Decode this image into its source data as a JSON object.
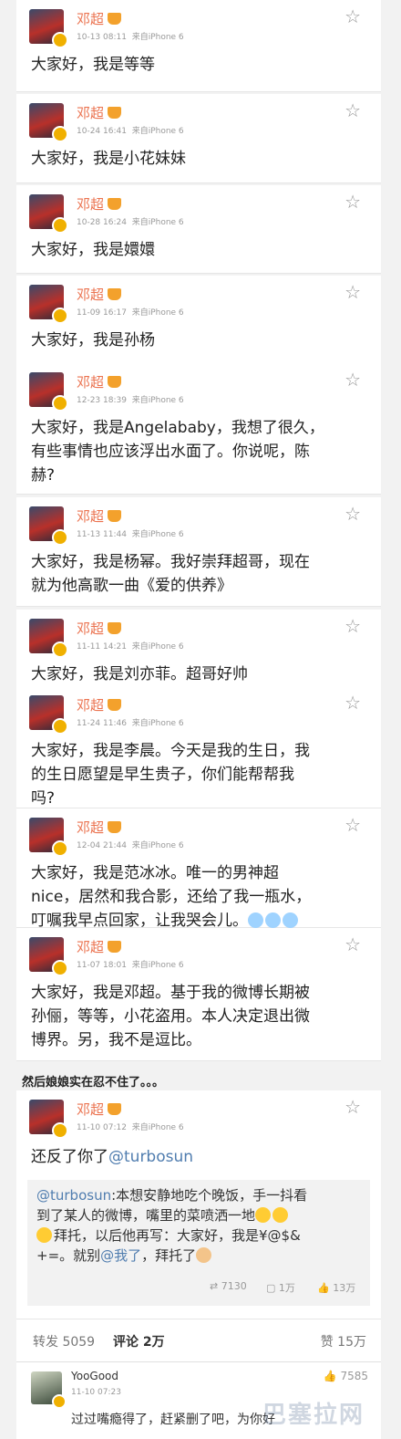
{
  "posts": [
    {
      "name": "邓超",
      "time": "10-13 08:11",
      "source": "来自iPhone 6",
      "text": [
        "大家好，我是等等"
      ]
    },
    {
      "name": "邓超",
      "time": "10-24 16:41",
      "source": "来自iPhone 6",
      "text": [
        "大家好，我是小花妹妹"
      ]
    },
    {
      "name": "邓超",
      "time": "10-28 16:24",
      "source": "来自iPhone 6",
      "text": [
        "大家好，我是嬛嬛"
      ]
    },
    {
      "name": "邓超",
      "time": "11-09 16:17",
      "source": "来自iPhone 6",
      "text": [
        "大家好，我是孙杨"
      ]
    },
    {
      "name": "邓超",
      "time": "12-23 18:39",
      "source": "来自iPhone 6",
      "text": [
        "大家好，我是Angelababy，我想了很久，",
        "有些事情也应该浮出水面了。你说呢，陈",
        "赫?"
      ]
    },
    {
      "name": "邓超",
      "time": "11-13 11:44",
      "source": "来自iPhone 6",
      "text": [
        "大家好，我是杨幂。我好崇拜超哥，现在",
        "就为他高歌一曲《爱的供养》"
      ]
    },
    {
      "name": "邓超",
      "time": "11-11 14:21",
      "source": "来自iPhone 6",
      "text": [
        "大家好，我是刘亦菲。超哥好帅"
      ]
    },
    {
      "name": "邓超",
      "time": "11-24 11:46",
      "source": "来自iPhone 6",
      "text": [
        "大家好，我是李晨。今天是我的生日，我",
        "的生日愿望是早生贵子，你们能帮帮我",
        "吗?"
      ]
    },
    {
      "name": "邓超",
      "time": "12-04 21:44",
      "source": "来自iPhone 6",
      "text": [
        "大家好，我是范冰冰。唯一的男神超",
        "nice，居然和我合影，还给了我一瓶水，",
        "叮嘱我早点回家，让我哭会儿。"
      ]
    },
    {
      "name": "邓超",
      "time": "11-07 18:01",
      "source": "来自iPhone 6",
      "text": [
        "大家好，我是邓超。基于我的微博长期被",
        "孙俪，等等，小花盗用。本人决定退出微",
        "博界。另，我不是逗比。"
      ]
    }
  ],
  "note": "然后娘娘实在忍不住了。。。",
  "final_post": {
    "name": "邓超",
    "time": "11-10 07:12",
    "source": "来自iPhone 6",
    "text_prefix": "还反了你了",
    "mention": "@turbosun",
    "rt_user": "@turbosun",
    "rt_lines": [
      ":本想安静地吃个晚饭，手一抖看",
      "到了某人的微博，嘴里的菜喷洒一地",
      "拜托，以后他再写：大家好，我是¥@$&",
      "+=。就别"
    ],
    "rt_mention": "@我了",
    "rt_tail": "，拜托了",
    "rt_stats": {
      "repost": "7130",
      "comment": "1万",
      "like": "13万"
    }
  },
  "tabs": {
    "repost": "转发 5059",
    "comment": "评论 2万",
    "like": "赞 15万"
  },
  "comment": {
    "user": "YooGood",
    "time": "11-10 07:23",
    "likes": "7585",
    "text": "过过嘴瘾得了，赶紧删了吧，为你好"
  },
  "watermark": "巴塞拉网"
}
